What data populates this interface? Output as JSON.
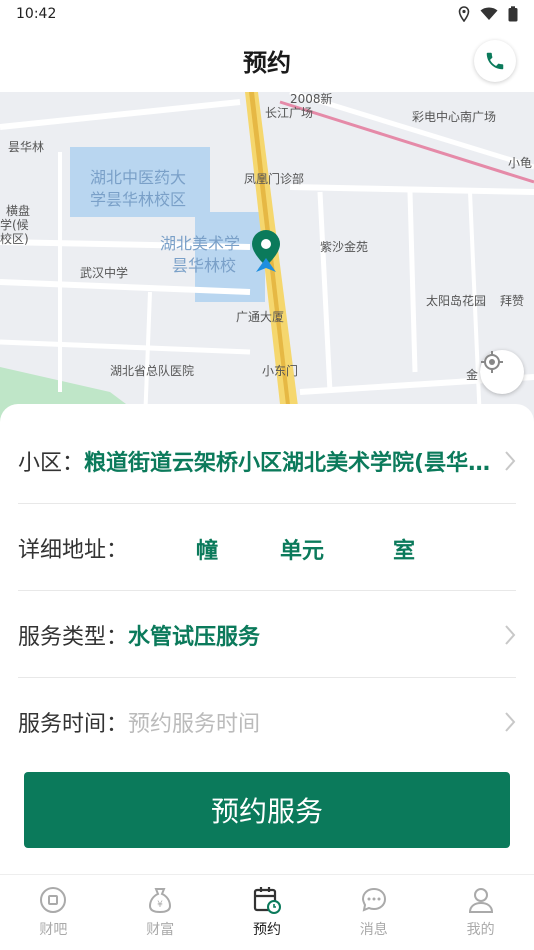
{
  "status_bar": {
    "time": "10:42"
  },
  "header": {
    "title": "预约",
    "phone_icon": "phone-icon"
  },
  "map": {
    "labels": {
      "l1": "2008新",
      "l2": "长江广场",
      "l3": "彩电中心南广场",
      "l4": "昙华林",
      "l5": "湖北中医药大",
      "l6": "学昙华林校区",
      "l7": "凤凰门诊部",
      "l8": "小龟",
      "l9": "横盘",
      "l10": "学(候",
      "l11": "校区)",
      "l12": "湖北美术学",
      "l13": "昙华林校",
      "l14": "紫沙金苑",
      "l15": "武汉中学",
      "l16": "太阳岛花园",
      "l17": "拜赞",
      "l18": "广通大厦",
      "l19": "湖北省总队医院",
      "l20": "小东门",
      "l21": "金"
    }
  },
  "form": {
    "community_label": "小区：",
    "community_value": "粮道街道云架桥小区湖北美术学院(昙华林校区)",
    "address_label": "详细地址：",
    "address_building": "幢",
    "address_unit": "单元",
    "address_room": "室",
    "service_type_label": "服务类型：",
    "service_type_value": "水管试压服务",
    "service_time_label": "服务时间：",
    "service_time_placeholder": "预约服务时间"
  },
  "submit_label": "预约服务",
  "tabs": [
    {
      "label": "财吧",
      "icon": "circle-square-icon"
    },
    {
      "label": "财富",
      "icon": "money-bag-icon"
    },
    {
      "label": "预约",
      "icon": "calendar-clock-icon",
      "active": true
    },
    {
      "label": "消息",
      "icon": "chat-bubble-icon"
    },
    {
      "label": "我的",
      "icon": "user-icon"
    }
  ],
  "colors": {
    "accent": "#0b7a5b",
    "placeholder": "#bbbbbb"
  }
}
